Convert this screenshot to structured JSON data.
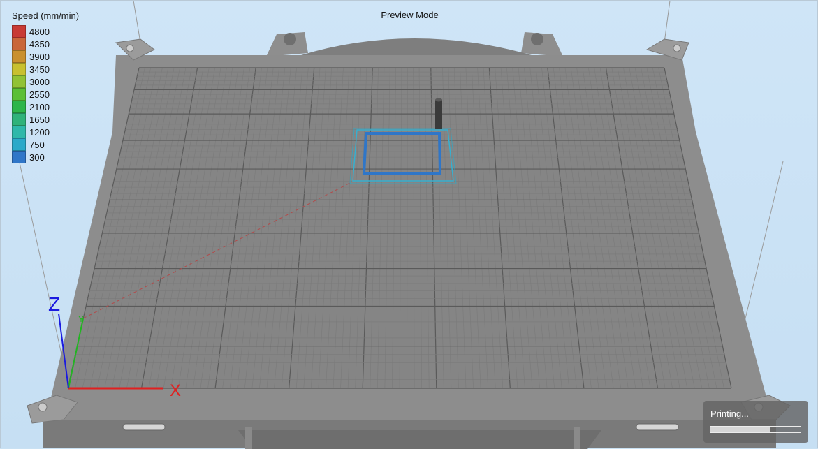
{
  "view": {
    "title": "Preview Mode"
  },
  "legend": {
    "title": "Speed (mm/min)",
    "items": [
      {
        "label": "4800",
        "color": "#c83a35"
      },
      {
        "label": "4350",
        "color": "#c9663a"
      },
      {
        "label": "3900",
        "color": "#c9902e"
      },
      {
        "label": "3450",
        "color": "#c8c030"
      },
      {
        "label": "3000",
        "color": "#91c235"
      },
      {
        "label": "2550",
        "color": "#5bbf36"
      },
      {
        "label": "2100",
        "color": "#2db54a"
      },
      {
        "label": "1650",
        "color": "#2fb27a"
      },
      {
        "label": "1200",
        "color": "#2fb8aa"
      },
      {
        "label": "750",
        "color": "#2aa9c9"
      },
      {
        "label": "300",
        "color": "#2f76c8"
      }
    ]
  },
  "axes": {
    "x_label": "X",
    "y_label": "Y",
    "z_label": "Z",
    "x_color": "#e02020",
    "y_color": "#22b522",
    "z_color": "#1a1ae0"
  },
  "status": {
    "label": "Printing...",
    "progress": 0.66
  }
}
